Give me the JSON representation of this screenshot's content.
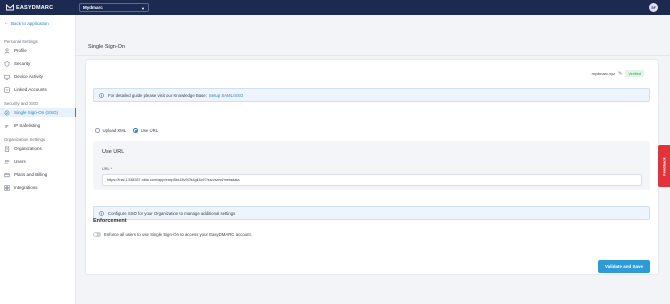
{
  "header": {
    "brand": "EASYDMARC",
    "org_name": "Mydmarc",
    "avatar_initials": "SF"
  },
  "sidebar": {
    "back_label": "Back to application",
    "sections": [
      {
        "title": "Personal Settings"
      },
      {
        "title": "Security and SSO"
      },
      {
        "title": "Organization Settings"
      }
    ],
    "items": [
      {
        "label": "Profile",
        "icon": "user-icon"
      },
      {
        "label": "Security",
        "icon": "shield-icon"
      },
      {
        "label": "Device Activity",
        "icon": "device-icon"
      },
      {
        "label": "Linked Accounts",
        "icon": "link-icon"
      },
      {
        "label": "Single Sign-On (SSO)",
        "icon": "sso-icon",
        "active": true
      },
      {
        "label": "IP Safelisting",
        "icon": "ip-icon"
      },
      {
        "label": "Organizations",
        "icon": "organization-icon"
      },
      {
        "label": "Users",
        "icon": "users-icon"
      },
      {
        "label": "Plans and Billing",
        "icon": "billing-icon"
      },
      {
        "label": "Integrations",
        "icon": "integrations-icon"
      }
    ]
  },
  "page": {
    "title": "Single Sign-On",
    "domain": "mydmarc.xyz",
    "verified_label": "Verified",
    "guide_text": "For detailed guide please visit our Knowledge Base:",
    "guide_link": "Setup SAML/SSO",
    "radio_upload": "Upload XML",
    "radio_url": "Use URL",
    "url_section_title": "Use URL",
    "url_label": "URL *",
    "url_value": "https://trial-1338287.okta.com/app/exkp8ks18v9Ok4gil1k97/sso/saml/metadata",
    "configure_text": "Configure SSO for your Organization to manage additional settings",
    "enforcement_title": "Enforcement",
    "enforcement_text": "Enforce all users to use Single Sign-On to access your EasyDMARC account.",
    "save_label": "Validate and Save",
    "feedback_label": "Feedback"
  },
  "colors": {
    "topbar": "#1c2a52",
    "accent": "#2e7fc9",
    "button": "#2e9bd6",
    "feedback": "#e2323a",
    "verified": "#2f9b57"
  }
}
